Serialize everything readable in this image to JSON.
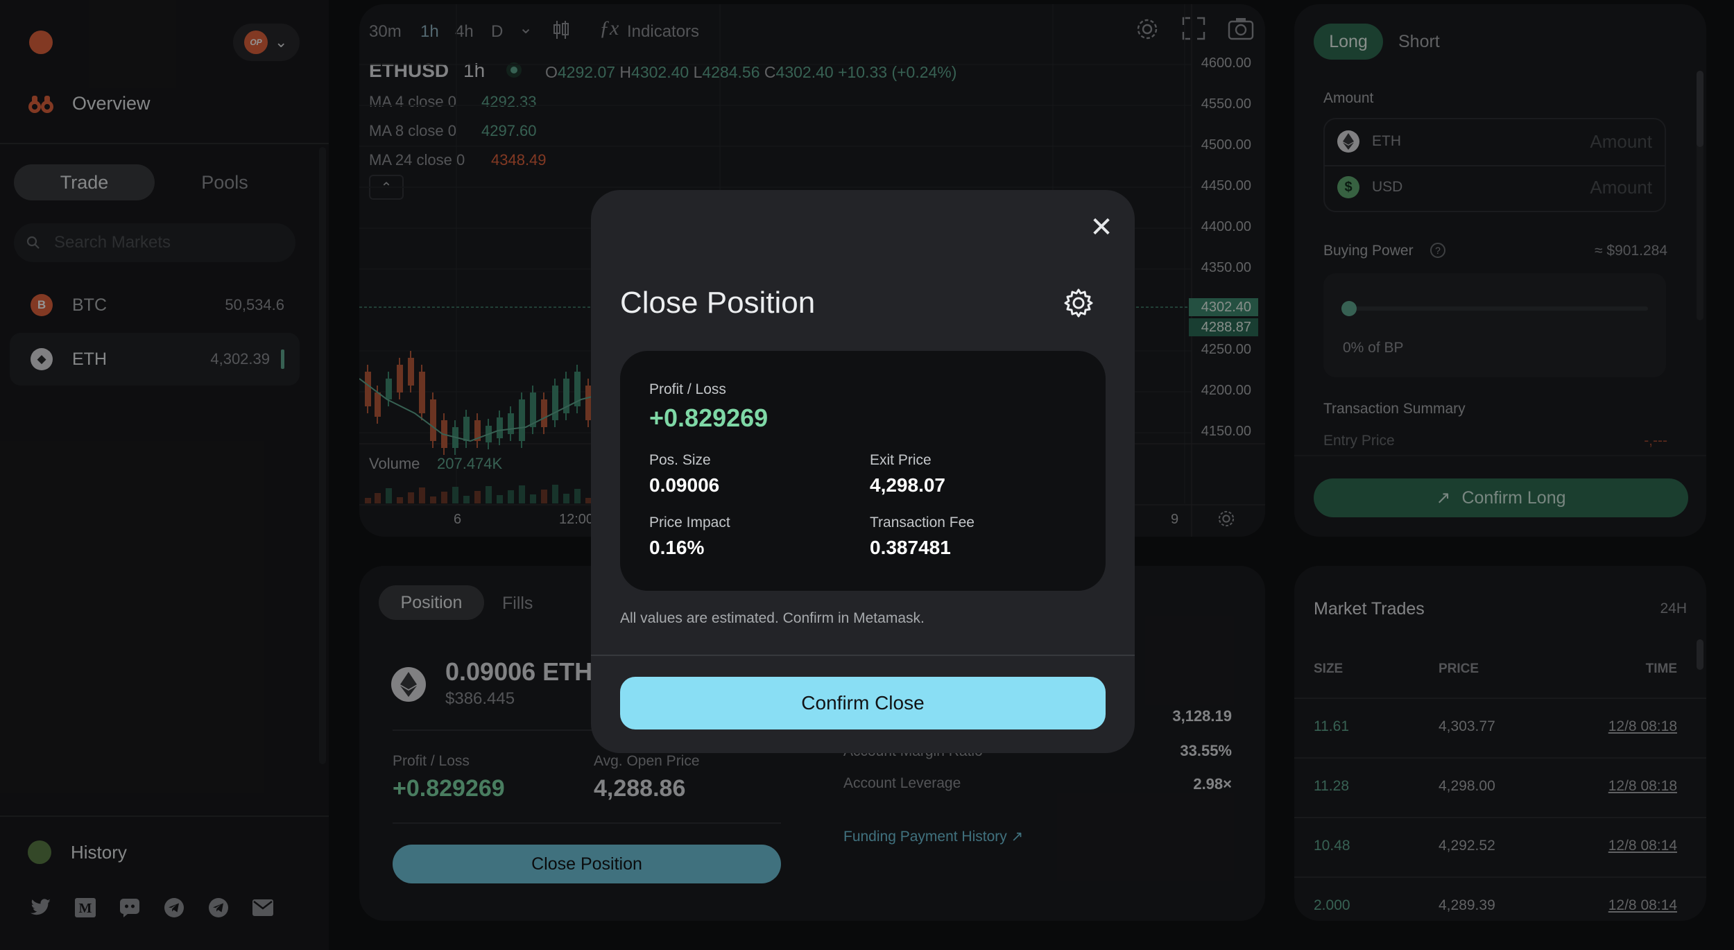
{
  "sidebar": {
    "network_badge": "OP",
    "overview_label": "Overview",
    "tabs": {
      "trade": "Trade",
      "pools": "Pools"
    },
    "search_placeholder": "Search Markets",
    "markets": [
      {
        "symbol": "BTC",
        "price": "50,534.6",
        "icon": "B"
      },
      {
        "symbol": "ETH",
        "price": "4,302.39",
        "icon": "◆"
      }
    ],
    "history_label": "History",
    "socials": [
      "twitter-icon",
      "medium-icon",
      "discord-icon",
      "telegram-icon",
      "telegram-icon",
      "mail-icon"
    ]
  },
  "chart": {
    "timeframes": [
      "30m",
      "1h",
      "4h",
      "D"
    ],
    "active_timeframe": "1h",
    "indicators_label": "Indicators",
    "symbol": "ETHUSD",
    "interval": "1h",
    "ohlc": {
      "o_label": "O",
      "o": "4292.07",
      "h_label": "H",
      "h": "4302.40",
      "l_label": "L",
      "l": "4284.56",
      "c_label": "C",
      "c": "4302.40",
      "change": "+10.33 (+0.24%)"
    },
    "ma": [
      {
        "label": "MA 4 close 0",
        "value": "4292.33",
        "color": "#5fa890"
      },
      {
        "label": "MA 8 close 0",
        "value": "4297.60",
        "color": "#5fa890"
      },
      {
        "label": "MA 24 close 0",
        "value": "4348.49",
        "color": "#e0623d"
      }
    ],
    "y_axis": [
      "4600.00",
      "4550.00",
      "4500.00",
      "4450.00",
      "4400.00",
      "4350.00",
      "4250.00",
      "4200.00",
      "4150.00"
    ],
    "price_tag_current": "4302.40",
    "price_tag_countdown": "4288.87",
    "volume_label": "Volume",
    "volume_value": "207.474K",
    "x_axis": [
      "6",
      "12:00",
      "9"
    ]
  },
  "position": {
    "tabs": {
      "position": "Position",
      "fills": "Fills"
    },
    "size": "0.09006 ETH",
    "usd": "$386.445",
    "pl_label": "Profit / Loss",
    "pl_value": "+0.829269",
    "avg_label": "Avg. Open Price",
    "avg_value": "4,288.86",
    "close_btn": "Close Position",
    "account_rows": [
      {
        "label": "",
        "value": "3,128.19"
      },
      {
        "label": "Account Margin Ratio",
        "value": "33.55%"
      },
      {
        "label": "Account Leverage",
        "value": "2.98×"
      }
    ],
    "funding_link": "Funding Payment History ↗"
  },
  "order": {
    "tabs": {
      "long": "Long",
      "short": "Short"
    },
    "amount_label": "Amount",
    "inputs": [
      {
        "asset": "ETH",
        "placeholder": "Amount"
      },
      {
        "asset": "USD",
        "placeholder": "Amount"
      }
    ],
    "buying_power_label": "Buying Power",
    "buying_power_value": "≈ $901.284",
    "slider_label": "0% of BP",
    "slider_value": 0,
    "summary_label": "Transaction Summary",
    "entry_label": "Entry Price",
    "entry_value": "-,---",
    "confirm_label": "Confirm Long"
  },
  "trades": {
    "title": "Market Trades",
    "period": "24H",
    "headers": [
      "SIZE",
      "PRICE",
      "TIME"
    ],
    "rows": [
      {
        "size": "11.61",
        "price": "4,303.77",
        "time": "12/8 08:18"
      },
      {
        "size": "11.28",
        "price": "4,298.00",
        "time": "12/8 08:18"
      },
      {
        "size": "10.48",
        "price": "4,292.52",
        "time": "12/8 08:14"
      },
      {
        "size": "2.000",
        "price": "4,289.39",
        "time": "12/8 08:14"
      }
    ]
  },
  "modal": {
    "title": "Close Position",
    "pl_label": "Profit / Loss",
    "pl_value": "+0.829269",
    "pos_size_label": "Pos. Size",
    "pos_size_value": "0.09006",
    "exit_price_label": "Exit Price",
    "exit_price_value": "4,298.07",
    "price_impact_label": "Price Impact",
    "price_impact_value": "0.16%",
    "fee_label": "Transaction Fee",
    "fee_value": "0.387481",
    "note": "All values are estimated. Confirm in Metamask.",
    "confirm_label": "Confirm Close"
  },
  "colors": {
    "accent": "#89def4",
    "profit": "#7fd8a6",
    "loss": "#e0623d",
    "long": "#2f6b52"
  }
}
